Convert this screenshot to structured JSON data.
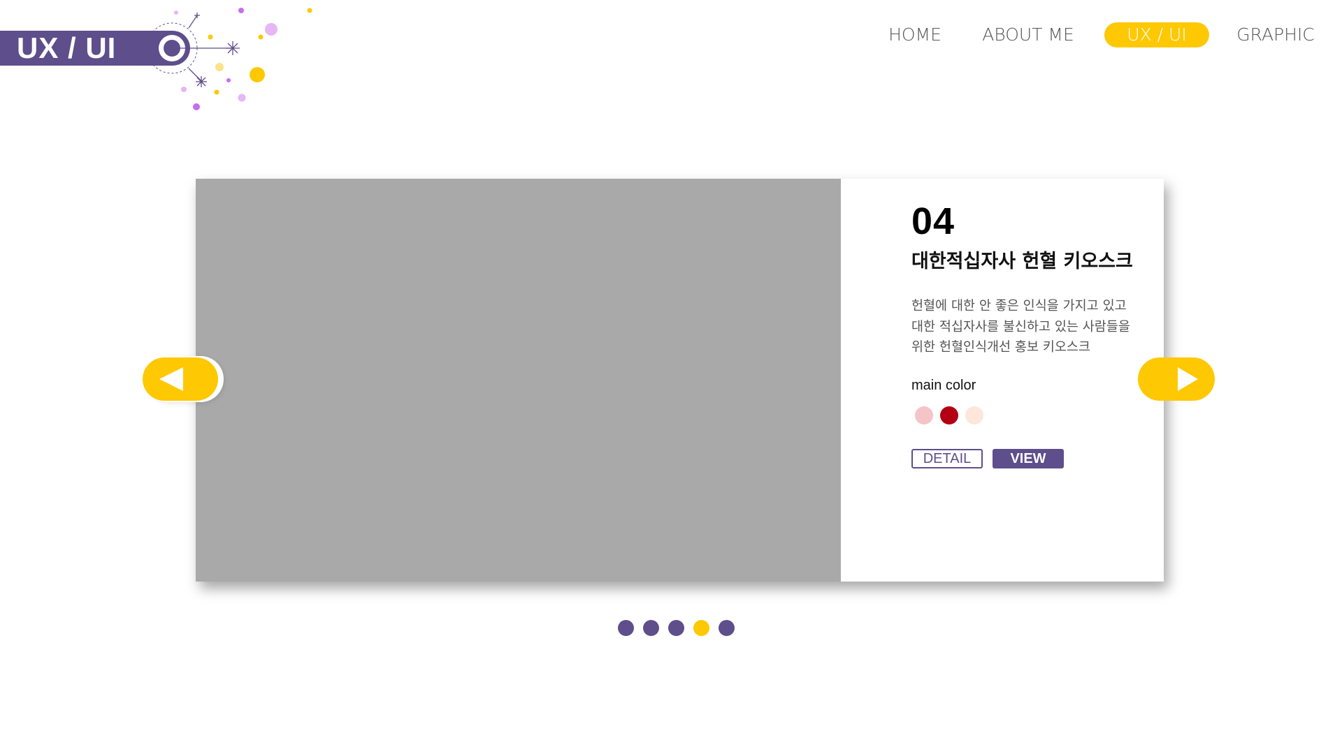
{
  "header": {
    "title": "UX / UI"
  },
  "nav": {
    "items": [
      {
        "label": "HOME",
        "active": false
      },
      {
        "label": "ABOUT ME",
        "active": false
      },
      {
        "label": "UX / UI",
        "active": true
      },
      {
        "label": "GRAPHIC",
        "active": false
      }
    ]
  },
  "slide": {
    "number": "04",
    "title": "대한적십자사 헌혈 키오스크",
    "description_lines": [
      "헌혈에 대한 안 좋은 인식을 가지고 있고",
      "대한 적십자사를 불신하고 있는 사람들을",
      "위한 헌혈인식개선 홍보 키오스크"
    ],
    "main_color_label": "main color",
    "main_colors": [
      "#f4c4c6",
      "#b30012",
      "#fde6da"
    ],
    "detail_label": "DETAIL",
    "view_label": "VIEW"
  },
  "slider": {
    "prev_icon": "arrow-left-icon",
    "next_icon": "arrow-right-icon",
    "total_slides": 5,
    "current_slide": 4
  },
  "colors": {
    "accent": "#fec803",
    "brand": "#5e4e8c",
    "placeholder": "#a9a9a9"
  }
}
